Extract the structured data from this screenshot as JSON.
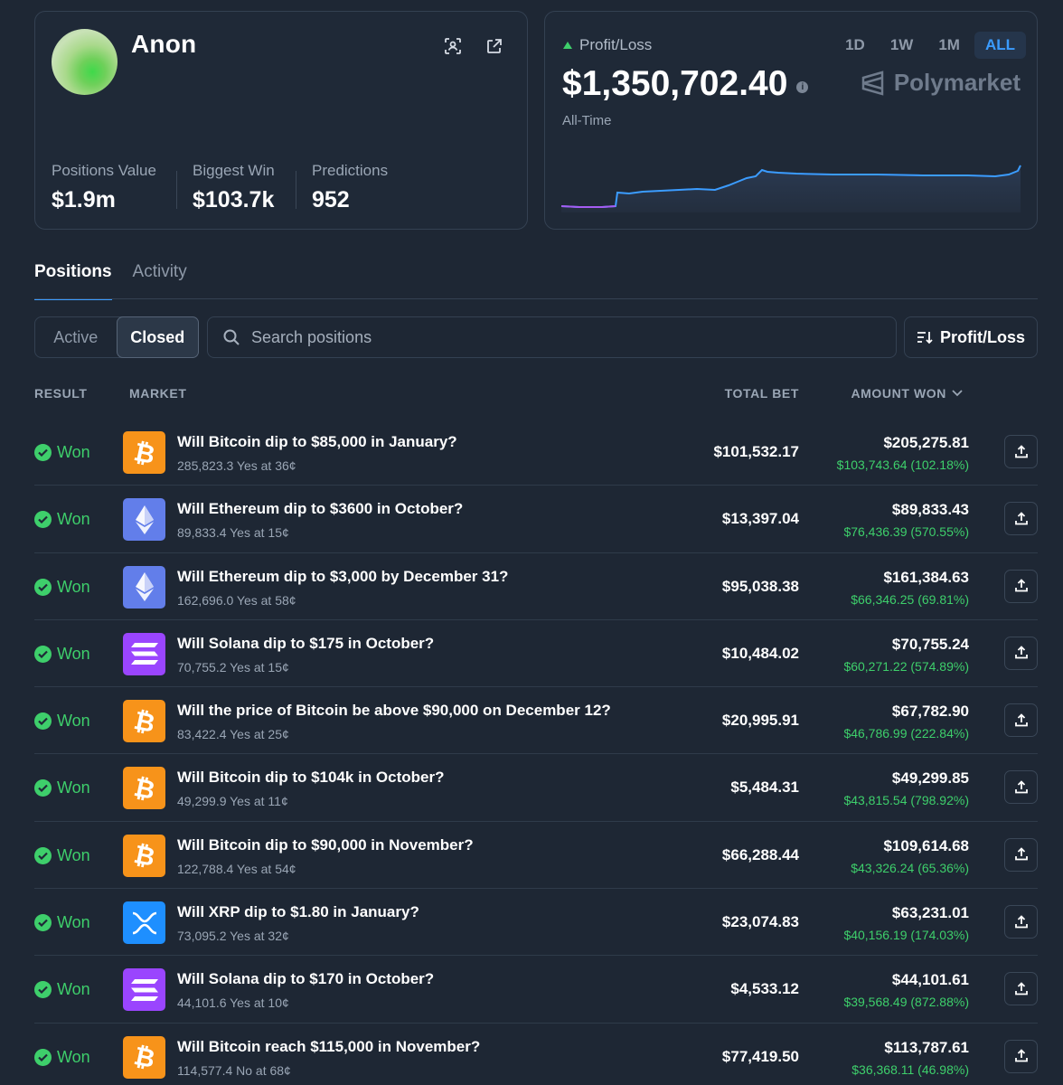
{
  "profile": {
    "username": "Anon",
    "stats": [
      {
        "label": "Positions Value",
        "value": "$1.9m"
      },
      {
        "label": "Biggest Win",
        "value": "$103.7k"
      },
      {
        "label": "Predictions",
        "value": "952"
      }
    ],
    "icons": [
      "scan-icon",
      "external-link-icon"
    ]
  },
  "pnl": {
    "label": "Profit/Loss",
    "value": "$1,350,702.40",
    "period": "All-Time",
    "brand": "Polymarket",
    "ranges": [
      "1D",
      "1W",
      "1M",
      "ALL"
    ],
    "active_range": "ALL",
    "trend_color": "#3ecf6b",
    "accent_color": "#3b9cff"
  },
  "tabs": [
    "Positions",
    "Activity"
  ],
  "active_tab": "Positions",
  "filter": {
    "options": [
      "Active",
      "Closed"
    ],
    "selected": "Closed",
    "search_placeholder": "Search positions",
    "sort_label": "Profit/Loss"
  },
  "table": {
    "columns": {
      "result": "RESULT",
      "market": "MARKET",
      "total_bet": "TOTAL BET",
      "amount_won": "AMOUNT WON"
    },
    "rows": [
      {
        "result": "Won",
        "coin": "btc",
        "title": "Will Bitcoin dip to $85,000 in January?",
        "sub": "285,823.3 Yes at 36¢",
        "bet": "$101,532.17",
        "won": "$205,275.81",
        "gain": "$103,743.64 (102.18%)"
      },
      {
        "result": "Won",
        "coin": "eth",
        "title": "Will Ethereum dip to $3600 in October?",
        "sub": "89,833.4 Yes at 15¢",
        "bet": "$13,397.04",
        "won": "$89,833.43",
        "gain": "$76,436.39 (570.55%)"
      },
      {
        "result": "Won",
        "coin": "eth",
        "title": "Will Ethereum dip to $3,000 by December 31?",
        "sub": "162,696.0 Yes at 58¢",
        "bet": "$95,038.38",
        "won": "$161,384.63",
        "gain": "$66,346.25 (69.81%)"
      },
      {
        "result": "Won",
        "coin": "sol",
        "title": "Will Solana dip to $175 in October?",
        "sub": "70,755.2 Yes at 15¢",
        "bet": "$10,484.02",
        "won": "$70,755.24",
        "gain": "$60,271.22 (574.89%)"
      },
      {
        "result": "Won",
        "coin": "btc",
        "title": "Will the price of Bitcoin be above $90,000 on December 12?",
        "sub": "83,422.4 Yes at 25¢",
        "bet": "$20,995.91",
        "won": "$67,782.90",
        "gain": "$46,786.99 (222.84%)"
      },
      {
        "result": "Won",
        "coin": "btc",
        "title": "Will Bitcoin dip to $104k in October?",
        "sub": "49,299.9 Yes at 11¢",
        "bet": "$5,484.31",
        "won": "$49,299.85",
        "gain": "$43,815.54 (798.92%)"
      },
      {
        "result": "Won",
        "coin": "btc",
        "title": "Will Bitcoin dip to $90,000 in November?",
        "sub": "122,788.4 Yes at 54¢",
        "bet": "$66,288.44",
        "won": "$109,614.68",
        "gain": "$43,326.24 (65.36%)"
      },
      {
        "result": "Won",
        "coin": "xrp",
        "title": "Will XRP dip to $1.80 in January?",
        "sub": "73,095.2 Yes at 32¢",
        "bet": "$23,074.83",
        "won": "$63,231.01",
        "gain": "$40,156.19 (174.03%)"
      },
      {
        "result": "Won",
        "coin": "sol",
        "title": "Will Solana dip to $170 in October?",
        "sub": "44,101.6 Yes at 10¢",
        "bet": "$4,533.12",
        "won": "$44,101.61",
        "gain": "$39,568.49 (872.88%)"
      },
      {
        "result": "Won",
        "coin": "btc",
        "title": "Will Bitcoin reach $115,000 in November?",
        "sub": "114,577.4 No at 68¢",
        "bet": "$77,419.50",
        "won": "$113,787.61",
        "gain": "$36,368.11 (46.98%)"
      }
    ]
  }
}
